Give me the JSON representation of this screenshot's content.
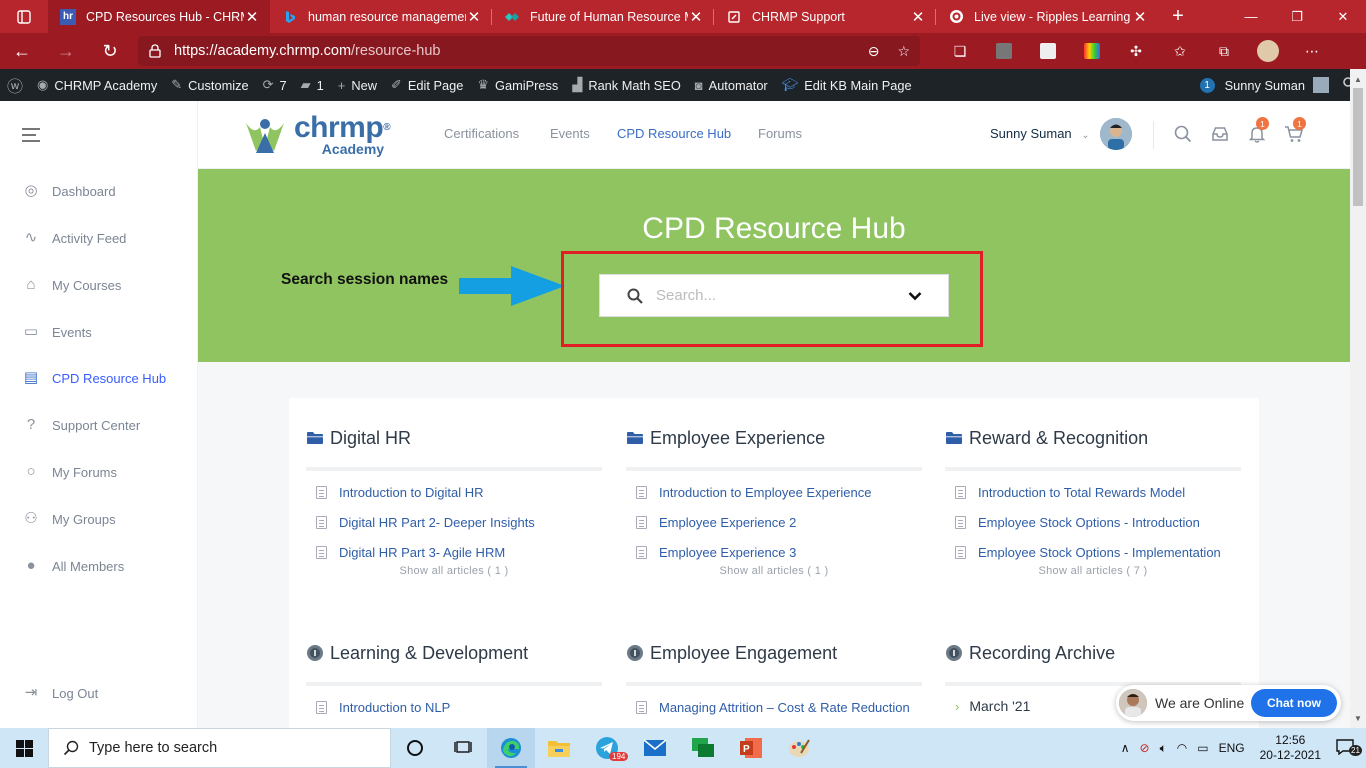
{
  "browser": {
    "tabs": [
      {
        "title": "CPD Resources Hub - CHRMP",
        "active": true,
        "favicon": "hr"
      },
      {
        "title": "human resource managemen",
        "active": false,
        "favicon": "bing-icon"
      },
      {
        "title": "Future of Human Resource M",
        "active": false,
        "favicon": "diamond-icon"
      },
      {
        "title": "CHRMP Support",
        "active": false,
        "favicon": "freshdesk-icon"
      },
      {
        "title": "Live view - Ripples Learning",
        "active": false,
        "favicon": "target-icon"
      }
    ],
    "url_domain": "https://academy.chrmp.com",
    "url_path": "/resource-hub",
    "accent": "#b7262c"
  },
  "wp_admin_bar": {
    "site_name": "CHRMP Academy",
    "customize": "Customize",
    "updates_count": "7",
    "comments_count": "1",
    "new_label": "New",
    "edit_page": "Edit Page",
    "gamipress": "GamiPress",
    "rank_math": "Rank Math SEO",
    "automator": "Automator",
    "edit_kb": "Edit KB Main Page",
    "notif_count": "1",
    "user": "Sunny Suman"
  },
  "sidebar": {
    "items": [
      {
        "label": "Dashboard",
        "icon": "palette-icon"
      },
      {
        "label": "Activity Feed",
        "icon": "activity-icon"
      },
      {
        "label": "My Courses",
        "icon": "graduation-cap-icon"
      },
      {
        "label": "Events",
        "icon": "calendar-icon"
      },
      {
        "label": "CPD Resource Hub",
        "icon": "book-open-icon",
        "active": true
      },
      {
        "label": "Support Center",
        "icon": "help-circle-icon"
      },
      {
        "label": "My Forums",
        "icon": "chat-bubble-icon"
      },
      {
        "label": "My Groups",
        "icon": "users-icon"
      },
      {
        "label": "All Members",
        "icon": "user-icon"
      }
    ],
    "logout": "Log Out"
  },
  "header": {
    "logo_main": "chrmp",
    "logo_reg": "®",
    "logo_sub": "Academy",
    "nav": [
      "Certifications",
      "Events",
      "CPD Resource Hub",
      "Forums"
    ],
    "user": "Sunny Suman",
    "notifications_count": "1",
    "cart_count": "1",
    "brand_color": "#3a6ea8"
  },
  "hero": {
    "title": "CPD Resource Hub",
    "search_placeholder": "Search...",
    "annotation": "Search session names",
    "bg_color": "#8fc460",
    "highlight_color": "#e11d26"
  },
  "categories": [
    {
      "name": "Digital HR",
      "icon": "folder-icon",
      "articles": [
        "Introduction to Digital HR",
        "Digital HR Part 2- Deeper Insights",
        "Digital HR Part 3- Agile HRM"
      ],
      "show_all": "Show all articles ( 1 )"
    },
    {
      "name": "Employee Experience",
      "icon": "folder-icon",
      "articles": [
        "Introduction to Employee Experience",
        "Employee Experience 2",
        "Employee Experience 3"
      ],
      "show_all": "Show all articles ( 1 )"
    },
    {
      "name": "Reward & Recognition",
      "icon": "folder-icon",
      "articles": [
        "Introduction to Total Rewards Model",
        "Employee Stock Options - Introduction",
        "Employee Stock Options - Implementation"
      ],
      "show_all": "Show all articles ( 7 )"
    },
    {
      "name": "Learning & Development",
      "icon": "info-icon",
      "articles": [
        "Introduction to NLP"
      ]
    },
    {
      "name": "Employee Engagement",
      "icon": "info-icon",
      "articles": [
        "Managing Attrition – Cost & Rate Reduction"
      ]
    },
    {
      "name": "Recording Archive",
      "icon": "info-icon",
      "archive": [
        "March '21"
      ]
    }
  ],
  "chat": {
    "status": "We are Online",
    "button": "Chat now"
  },
  "taskbar": {
    "search_placeholder": "Type here to search",
    "telegram_badge": "194",
    "language": "ENG",
    "time": "12:56",
    "date": "20-12-2021",
    "notif_count": "21"
  }
}
